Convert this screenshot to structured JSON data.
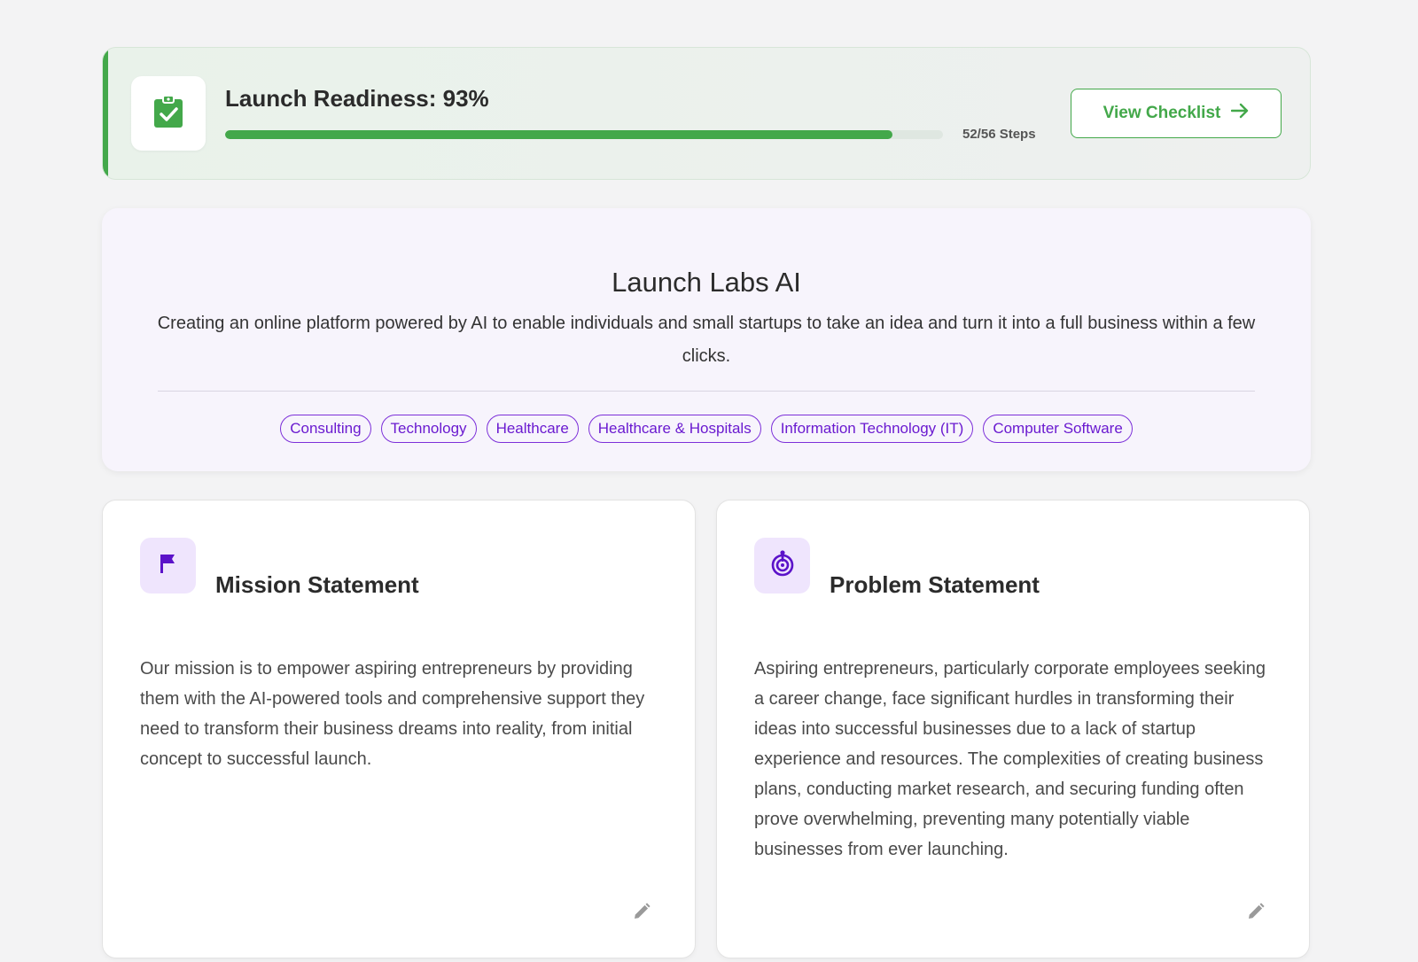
{
  "readiness": {
    "title": "Launch Readiness: 93%",
    "progress_fraction": 0.93,
    "steps": "52/56 Steps",
    "button_label": "View Checklist",
    "accent_color": "#43a84a"
  },
  "company": {
    "name": "Launch Labs AI",
    "description": "Creating an online platform powered by AI to enable individuals and small startups to take an idea and turn it into a full business within a few clicks.",
    "tags": [
      "Consulting",
      "Technology",
      "Healthcare",
      "Healthcare & Hospitals",
      "Information Technology (IT)",
      "Computer Software"
    ],
    "tag_color": "#7c2fd9"
  },
  "mission": {
    "icon": "flag-icon",
    "title": "Mission Statement",
    "text": "Our mission is to empower aspiring entrepreneurs by providing them with the AI-powered tools and comprehensive support they need to transform their business dreams into reality, from initial concept to successful launch."
  },
  "problem": {
    "icon": "target-icon",
    "title": "Problem Statement",
    "text": "Aspiring entrepreneurs, particularly corporate employees seeking a career change, face significant hurdles in transforming their ideas into successful businesses due to a lack of startup experience and resources. The complexities of creating business plans, conducting market research, and securing funding often prove overwhelming, preventing many potentially viable businesses from ever launching."
  }
}
